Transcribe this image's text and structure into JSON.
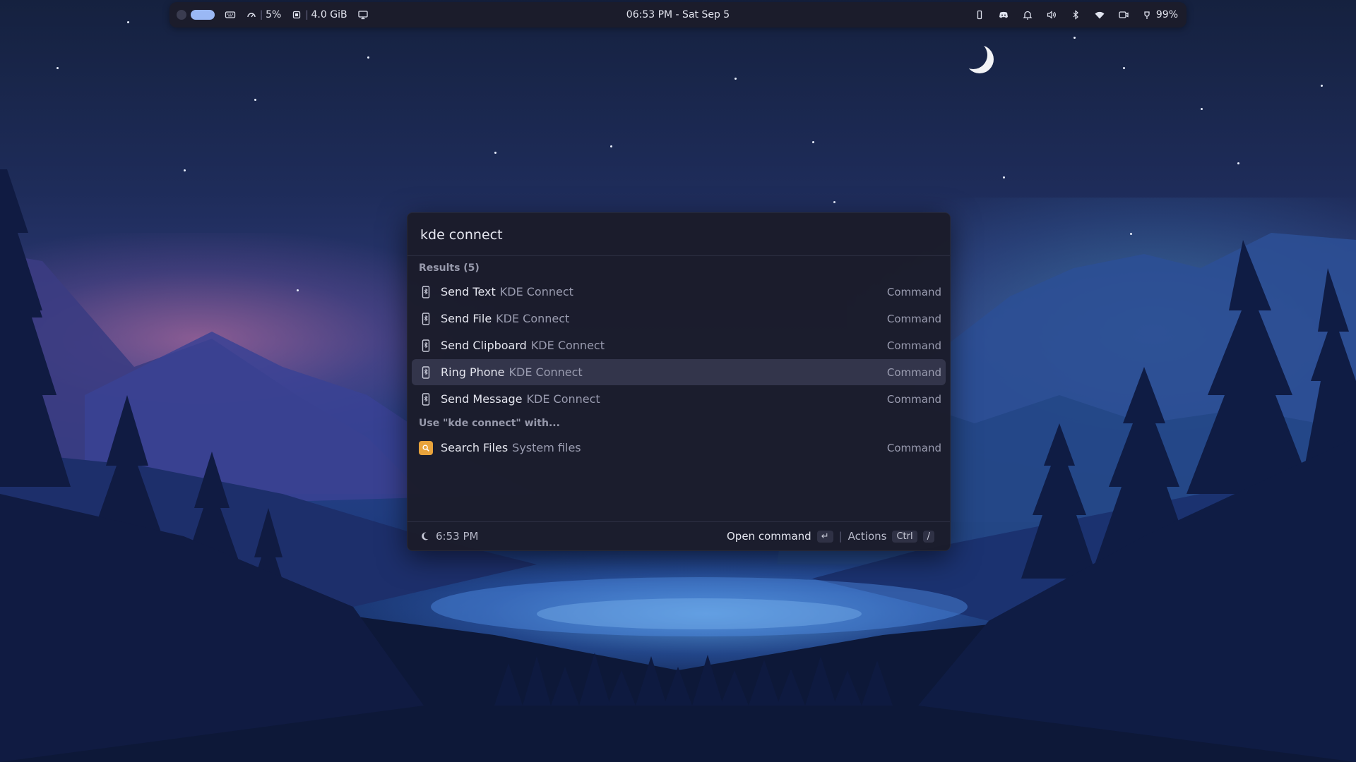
{
  "topbar": {
    "cpu": "5%",
    "memory": "4.0 GiB",
    "clock": "06:53 PM - Sat Sep 5",
    "battery": "99%"
  },
  "launcher": {
    "query": "kde connect",
    "results_header": "Results (5)",
    "results": [
      {
        "title": "Send Text",
        "subtitle": "KDE Connect",
        "kind": "Command"
      },
      {
        "title": "Send File",
        "subtitle": "KDE Connect",
        "kind": "Command"
      },
      {
        "title": "Send Clipboard",
        "subtitle": "KDE Connect",
        "kind": "Command"
      },
      {
        "title": "Ring Phone",
        "subtitle": "KDE Connect",
        "kind": "Command"
      },
      {
        "title": "Send Message",
        "subtitle": "KDE Connect",
        "kind": "Command"
      }
    ],
    "fallback_header": "Use \"kde connect\" with...",
    "fallback": [
      {
        "title": "Search Files",
        "subtitle": "System files",
        "kind": "Command"
      }
    ],
    "footer": {
      "time": "6:53 PM",
      "primary_action": "Open command",
      "primary_key": "↵",
      "actions_label": "Actions",
      "actions_key_1": "Ctrl",
      "actions_key_2": "/"
    }
  },
  "icons": {
    "result": "phone-icon",
    "fallback": "search-files-icon"
  },
  "colors": {
    "panel": "#1b1c2a",
    "selected_row": "#33354b",
    "workspace_active": "#9ab8f5",
    "files_icon": "#e8a33c"
  }
}
